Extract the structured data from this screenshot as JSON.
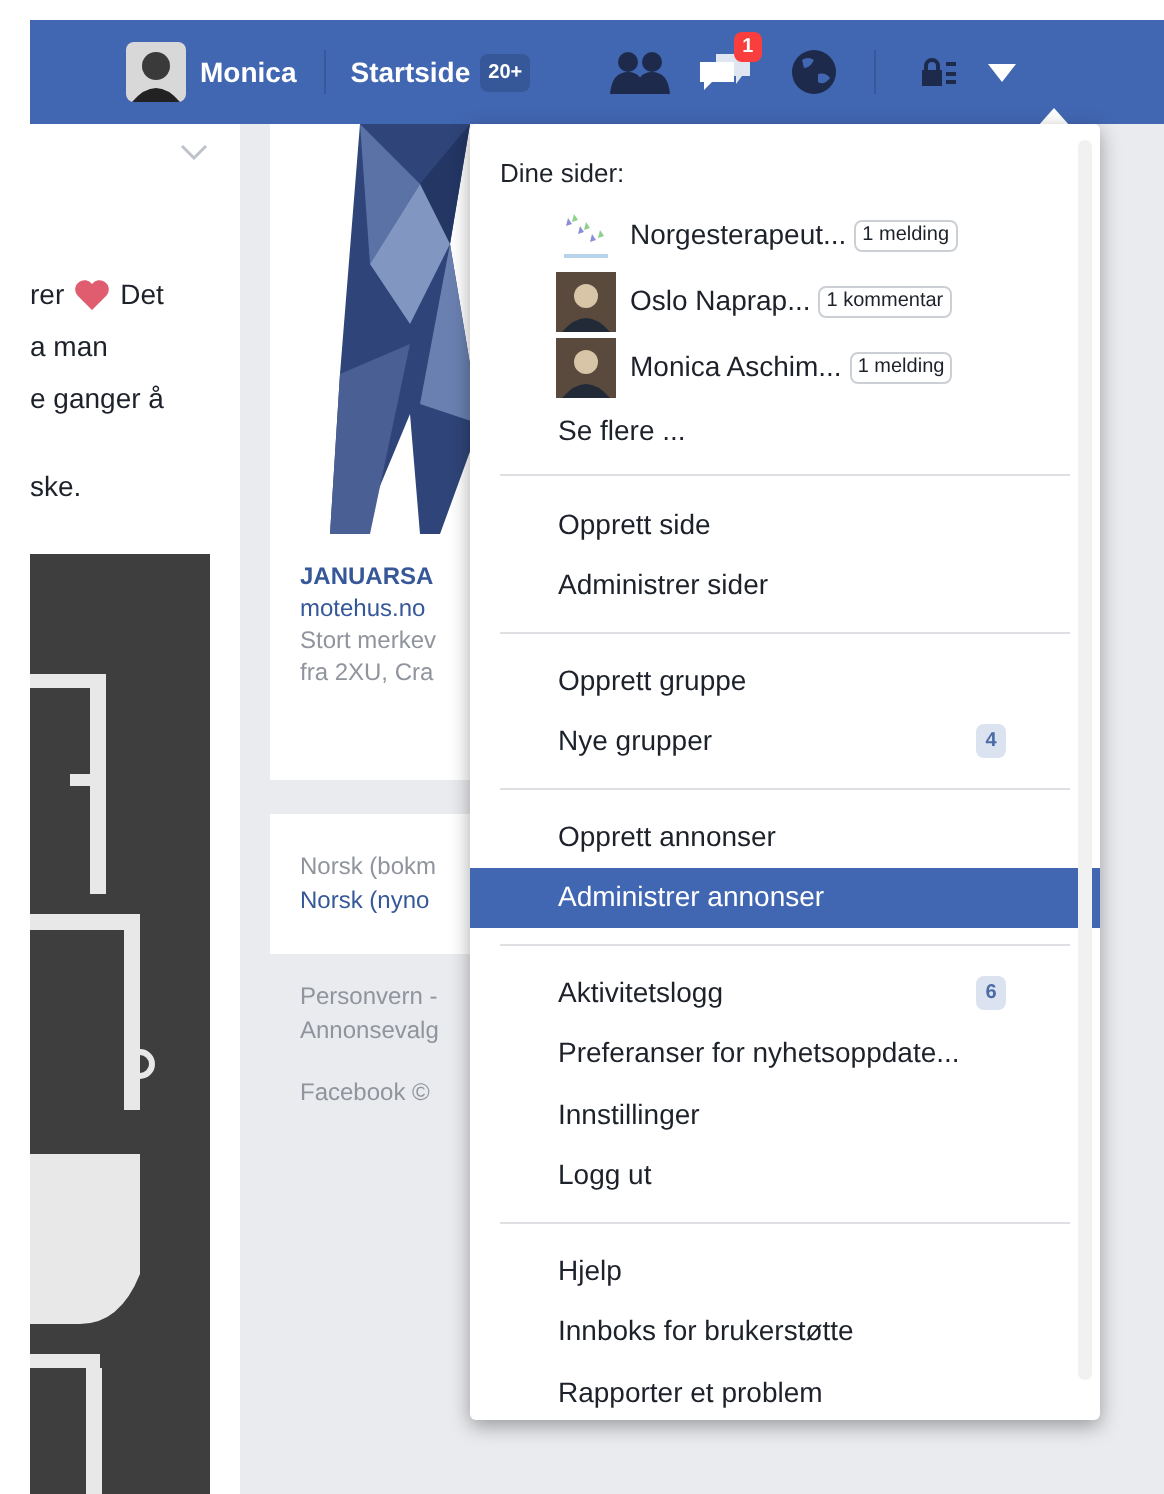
{
  "top_bar": {
    "profile_name": "Monica",
    "home": "Startside",
    "home_badge": "20+",
    "message_badge": "1"
  },
  "feed_post": {
    "lines": [
      "rer",
      "Det",
      "a man",
      "e ganger å",
      "ske."
    ]
  },
  "ad": {
    "title": "JANUARSA",
    "site": "motehus.no",
    "lines": [
      "Stort merkev",
      "fra 2XU, Cra"
    ]
  },
  "languages": [
    {
      "label": "Norsk (bokm",
      "link": false
    },
    {
      "label": "Norsk (nyno",
      "link": true
    }
  ],
  "footer": [
    "Personvern -",
    "Annonsevalg",
    "Facebook ©"
  ],
  "menu": {
    "heading": "Dine sider:",
    "pages": [
      {
        "name": "Norgesterapeut...",
        "badge": "1 melding",
        "kind": "logo"
      },
      {
        "name": "Oslo Naprap...",
        "badge": "1 kommentar"
      },
      {
        "name": "Monica Aschim...",
        "badge": "1 melding"
      }
    ],
    "more": "Se flere ...",
    "sections": [
      [
        {
          "label": "Opprett side",
          "selected": false
        },
        {
          "label": "Administrer sider",
          "selected": false
        }
      ],
      [
        {
          "label": "Opprett gruppe",
          "selected": false
        },
        {
          "label": "Nye grupper",
          "selected": false,
          "badge": "4"
        }
      ],
      [
        {
          "label": "Opprett annonser",
          "selected": false
        },
        {
          "label": "Administrer annonser",
          "selected": true
        }
      ],
      [
        {
          "label": "Aktivitetslogg",
          "selected": false,
          "badge": "6"
        },
        {
          "label": "Preferanser for nyhetsoppdate...",
          "selected": false
        },
        {
          "label": "Innstillinger",
          "selected": false
        },
        {
          "label": "Logg ut",
          "selected": false
        }
      ],
      [
        {
          "label": "Hjelp",
          "selected": false
        },
        {
          "label": "Innboks for brukerstøtte",
          "selected": false
        },
        {
          "label": "Rapporter et problem",
          "selected": false
        }
      ]
    ]
  }
}
